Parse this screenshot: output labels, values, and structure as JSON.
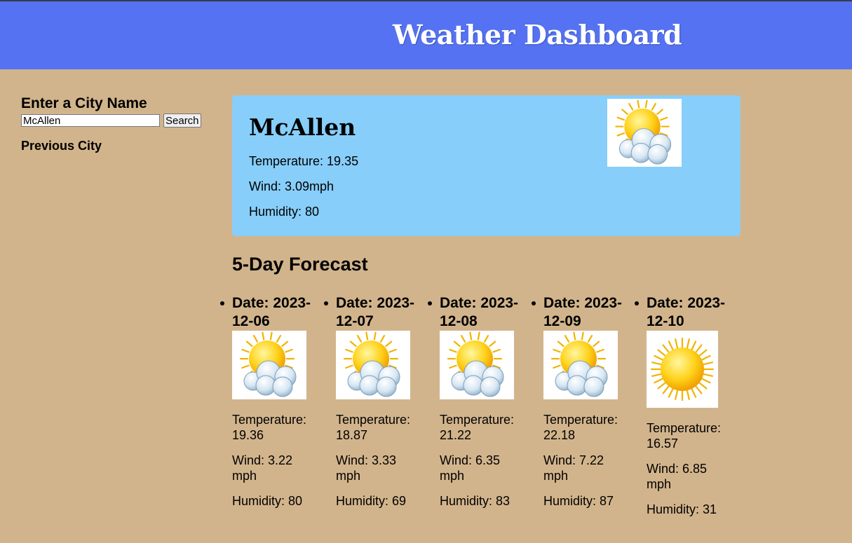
{
  "header": {
    "title": "Weather Dashboard"
  },
  "sidebar": {
    "heading": "Enter a City Name",
    "search_value": "McAllen",
    "search_label": "Search",
    "previous_heading": "Previous City"
  },
  "current": {
    "city": "McAllen",
    "temperature": "Temperature: 19.35",
    "wind": "Wind: 3.09mph",
    "humidity": "Humidity: 80",
    "icon": "partly-cloudy-icon"
  },
  "forecast": {
    "title": "5-Day Forecast",
    "days": [
      {
        "date": "Date: 2023-12-06",
        "temp": "Temperature: 19.36",
        "wind": "Wind: 3.22 mph",
        "humidity": "Humidity: 80",
        "icon": "partly-cloudy-icon"
      },
      {
        "date": "Date: 2023-12-07",
        "temp": "Temperature: 18.87",
        "wind": "Wind: 3.33 mph",
        "humidity": "Humidity: 69",
        "icon": "partly-cloudy-icon"
      },
      {
        "date": "Date: 2023-12-08",
        "temp": "Temperature: 21.22",
        "wind": "Wind: 6.35 mph",
        "humidity": "Humidity: 83",
        "icon": "partly-cloudy-icon"
      },
      {
        "date": "Date: 2023-12-09",
        "temp": "Temperature: 22.18",
        "wind": "Wind: 7.22 mph",
        "humidity": "Humidity: 87",
        "icon": "partly-cloudy-icon"
      },
      {
        "date": "Date: 2023-12-10",
        "temp": "Temperature: 16.57",
        "wind": "Wind: 6.85 mph",
        "humidity": "Humidity: 31",
        "icon": "sunny-icon"
      }
    ]
  },
  "colors": {
    "header": "#5472f2",
    "background": "#d2b48c",
    "card": "#87cefa"
  }
}
